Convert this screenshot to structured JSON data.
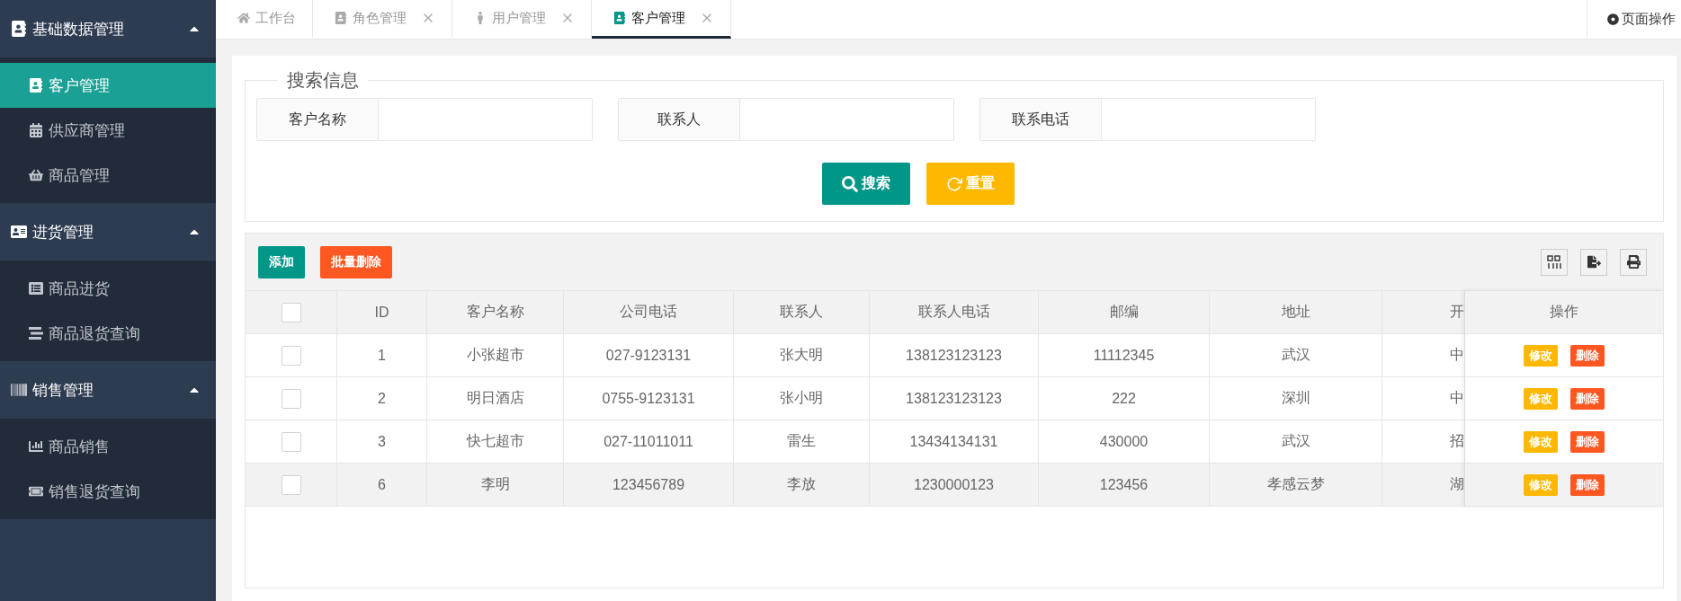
{
  "sidebar": {
    "groups": [
      {
        "title": "基础数据管理",
        "expanded": true,
        "items": [
          {
            "label": "客户管理",
            "selected": true
          },
          {
            "label": "供应商管理",
            "selected": false
          },
          {
            "label": "商品管理",
            "selected": false
          }
        ]
      },
      {
        "title": "进货管理",
        "expanded": true,
        "items": [
          {
            "label": "商品进货",
            "selected": false
          },
          {
            "label": "商品退货查询",
            "selected": false
          }
        ]
      },
      {
        "title": "销售管理",
        "expanded": true,
        "items": [
          {
            "label": "商品销售",
            "selected": false
          },
          {
            "label": "销售退货查询",
            "selected": false
          }
        ]
      }
    ]
  },
  "tabs": [
    {
      "label": "工作台",
      "closable": false,
      "selected": false
    },
    {
      "label": "角色管理",
      "closable": true,
      "selected": false
    },
    {
      "label": "用户管理",
      "closable": true,
      "selected": false
    },
    {
      "label": "客户管理",
      "closable": true,
      "selected": true
    }
  ],
  "page_actions": "页面操作",
  "search": {
    "title": "搜索信息",
    "fields": [
      {
        "label": "客户名称"
      },
      {
        "label": "联系人"
      },
      {
        "label": "联系电话"
      }
    ],
    "buttons": [
      {
        "label": "搜索",
        "kind": "primary"
      },
      {
        "label": "重置",
        "kind": "warning"
      }
    ]
  },
  "toolbar": {
    "buttons": [
      {
        "label": "添加",
        "kind": "primary"
      },
      {
        "label": "批量删除",
        "kind": "danger"
      }
    ]
  },
  "table": {
    "header_checked": false,
    "columns": [
      "ID",
      "客户名称",
      "公司电话",
      "联系人",
      "联系人电话",
      "邮编",
      "地址",
      "开"
    ],
    "action_column": "操作",
    "rows": [
      {
        "checked": false,
        "hovered": false,
        "cells": [
          "1",
          "小张超市",
          "027-9123131",
          "张大明",
          "138123123123",
          "11112345",
          "武汉",
          "中"
        ],
        "actions": [
          {
            "label": "修改",
            "kind": "warning"
          },
          {
            "label": "删除",
            "kind": "danger"
          }
        ]
      },
      {
        "checked": false,
        "hovered": false,
        "cells": [
          "2",
          "明日酒店",
          "0755-9123131",
          "张小明",
          "138123123123",
          "222",
          "深圳",
          "中"
        ],
        "actions": [
          {
            "label": "修改",
            "kind": "warning"
          },
          {
            "label": "删除",
            "kind": "danger"
          }
        ]
      },
      {
        "checked": false,
        "hovered": false,
        "cells": [
          "3",
          "快七超市",
          "027-11011011",
          "雷生",
          "13434134131",
          "430000",
          "武汉",
          "招"
        ],
        "actions": [
          {
            "label": "修改",
            "kind": "warning"
          },
          {
            "label": "删除",
            "kind": "danger"
          }
        ]
      },
      {
        "checked": false,
        "hovered": true,
        "cells": [
          "6",
          "李明",
          "123456789",
          "李放",
          "1230000123",
          "123456",
          "孝感云梦",
          "湖"
        ],
        "actions": [
          {
            "label": "修改",
            "kind": "warning"
          },
          {
            "label": "删除",
            "kind": "danger"
          }
        ]
      }
    ]
  }
}
